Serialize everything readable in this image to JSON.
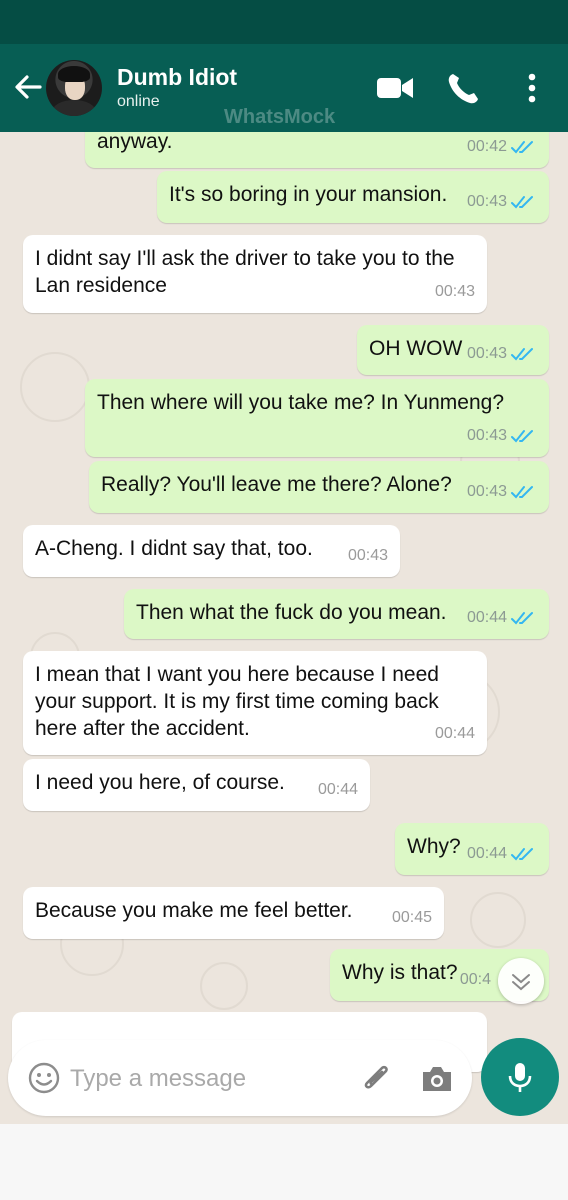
{
  "header": {
    "contact_name": "Dumb Idiot",
    "status": "online",
    "watermark": "WhatsMock",
    "accent_color": "#075e54"
  },
  "icons": {
    "back": "arrow-left-icon",
    "video": "video-call-icon",
    "call": "phone-icon",
    "menu": "more-vertical-icon",
    "emoji": "emoji-icon",
    "attach": "paperclip-icon",
    "camera": "camera-icon",
    "mic": "microphone-icon",
    "scroll": "chevron-down-icon"
  },
  "messages": [
    {
      "dir": "out",
      "text": "anyway.",
      "time": "00:42",
      "read": true
    },
    {
      "dir": "out",
      "text": "It's so boring in your mansion.",
      "time": "00:43",
      "read": true
    },
    {
      "dir": "in",
      "text": "I didnt say I'll ask the driver to take you to the Lan residence",
      "time": "00:43"
    },
    {
      "dir": "out",
      "text": "OH WOW",
      "time": "00:43",
      "read": true
    },
    {
      "dir": "out",
      "text": "Then where will you take me? In Yunmeng?",
      "time": "00:43",
      "read": true
    },
    {
      "dir": "out",
      "text": "Really? You'll leave me there? Alone?",
      "time": "00:43",
      "read": true
    },
    {
      "dir": "in",
      "text": "A-Cheng. I didnt say that, too.",
      "time": "00:43"
    },
    {
      "dir": "out",
      "text": "Then what the fuck do you mean.",
      "time": "00:44",
      "read": true
    },
    {
      "dir": "in",
      "text": "I mean that I want you here because I need your support. It is my first time coming back here after the accident.",
      "time": "00:44"
    },
    {
      "dir": "in",
      "text": "I need you here, of course.",
      "time": "00:44"
    },
    {
      "dir": "out",
      "text": "Why?",
      "time": "00:44",
      "read": true
    },
    {
      "dir": "in",
      "text": "Because you make me feel better.",
      "time": "00:45"
    },
    {
      "dir": "out",
      "text": "Why is that?",
      "time": "00:4",
      "read": true
    }
  ],
  "composer": {
    "placeholder": "Type a message"
  }
}
